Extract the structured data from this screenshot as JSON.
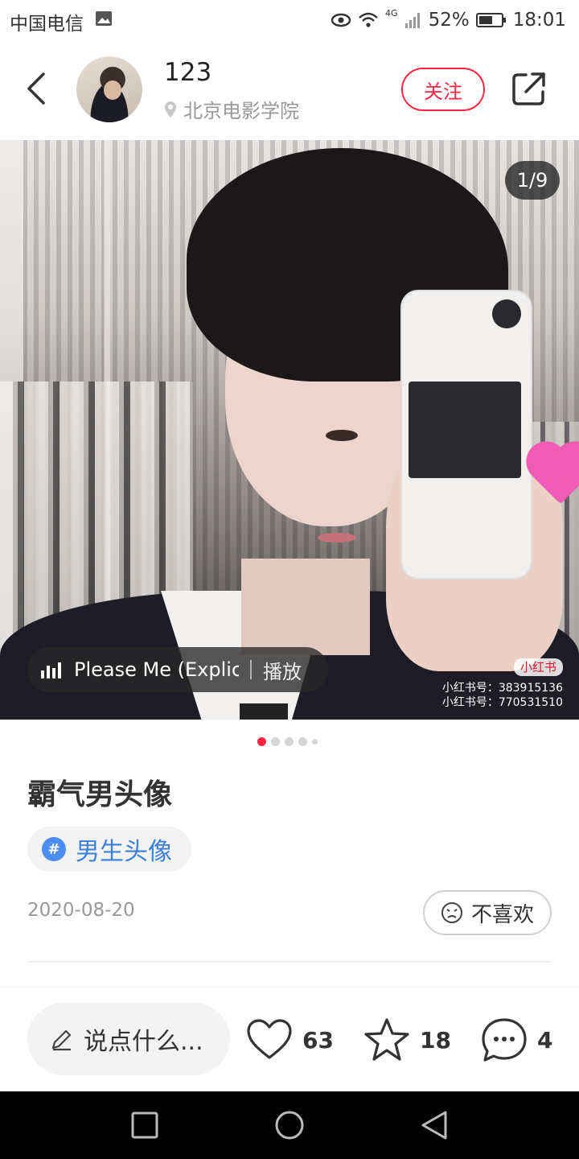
{
  "status_bar": {
    "carrier": "中国电信",
    "network": "4G",
    "battery": "52%",
    "time": "18:01"
  },
  "header": {
    "username": "123",
    "location": "北京电影学院",
    "follow_label": "关注"
  },
  "gallery": {
    "counter": "1/9",
    "page_count": 9,
    "current_page": 1,
    "music": {
      "song": "Please Me (Explicit",
      "play_label": "播放"
    },
    "watermark": {
      "logo": "小红书",
      "line1": "小红书号：383915136",
      "line2": "小红书号：770531510"
    }
  },
  "note": {
    "title": "霸气男头像",
    "tag": "男生头像",
    "date": "2020-08-20",
    "dislike_label": "不喜欢"
  },
  "actions": {
    "comment_placeholder": "说点什么...",
    "likes": "63",
    "collects": "18",
    "comments": "4"
  },
  "colors": {
    "accent": "#ff2442",
    "tag_blue": "#3a7fd9"
  },
  "icons": [
    "back-icon",
    "share-icon",
    "location-pin-icon",
    "music-bars-icon",
    "hashtag-icon",
    "dislike-face-icon",
    "pencil-icon",
    "heart-icon",
    "star-icon",
    "comment-icon",
    "nav-recent-icon",
    "nav-home-icon",
    "nav-back-icon"
  ]
}
